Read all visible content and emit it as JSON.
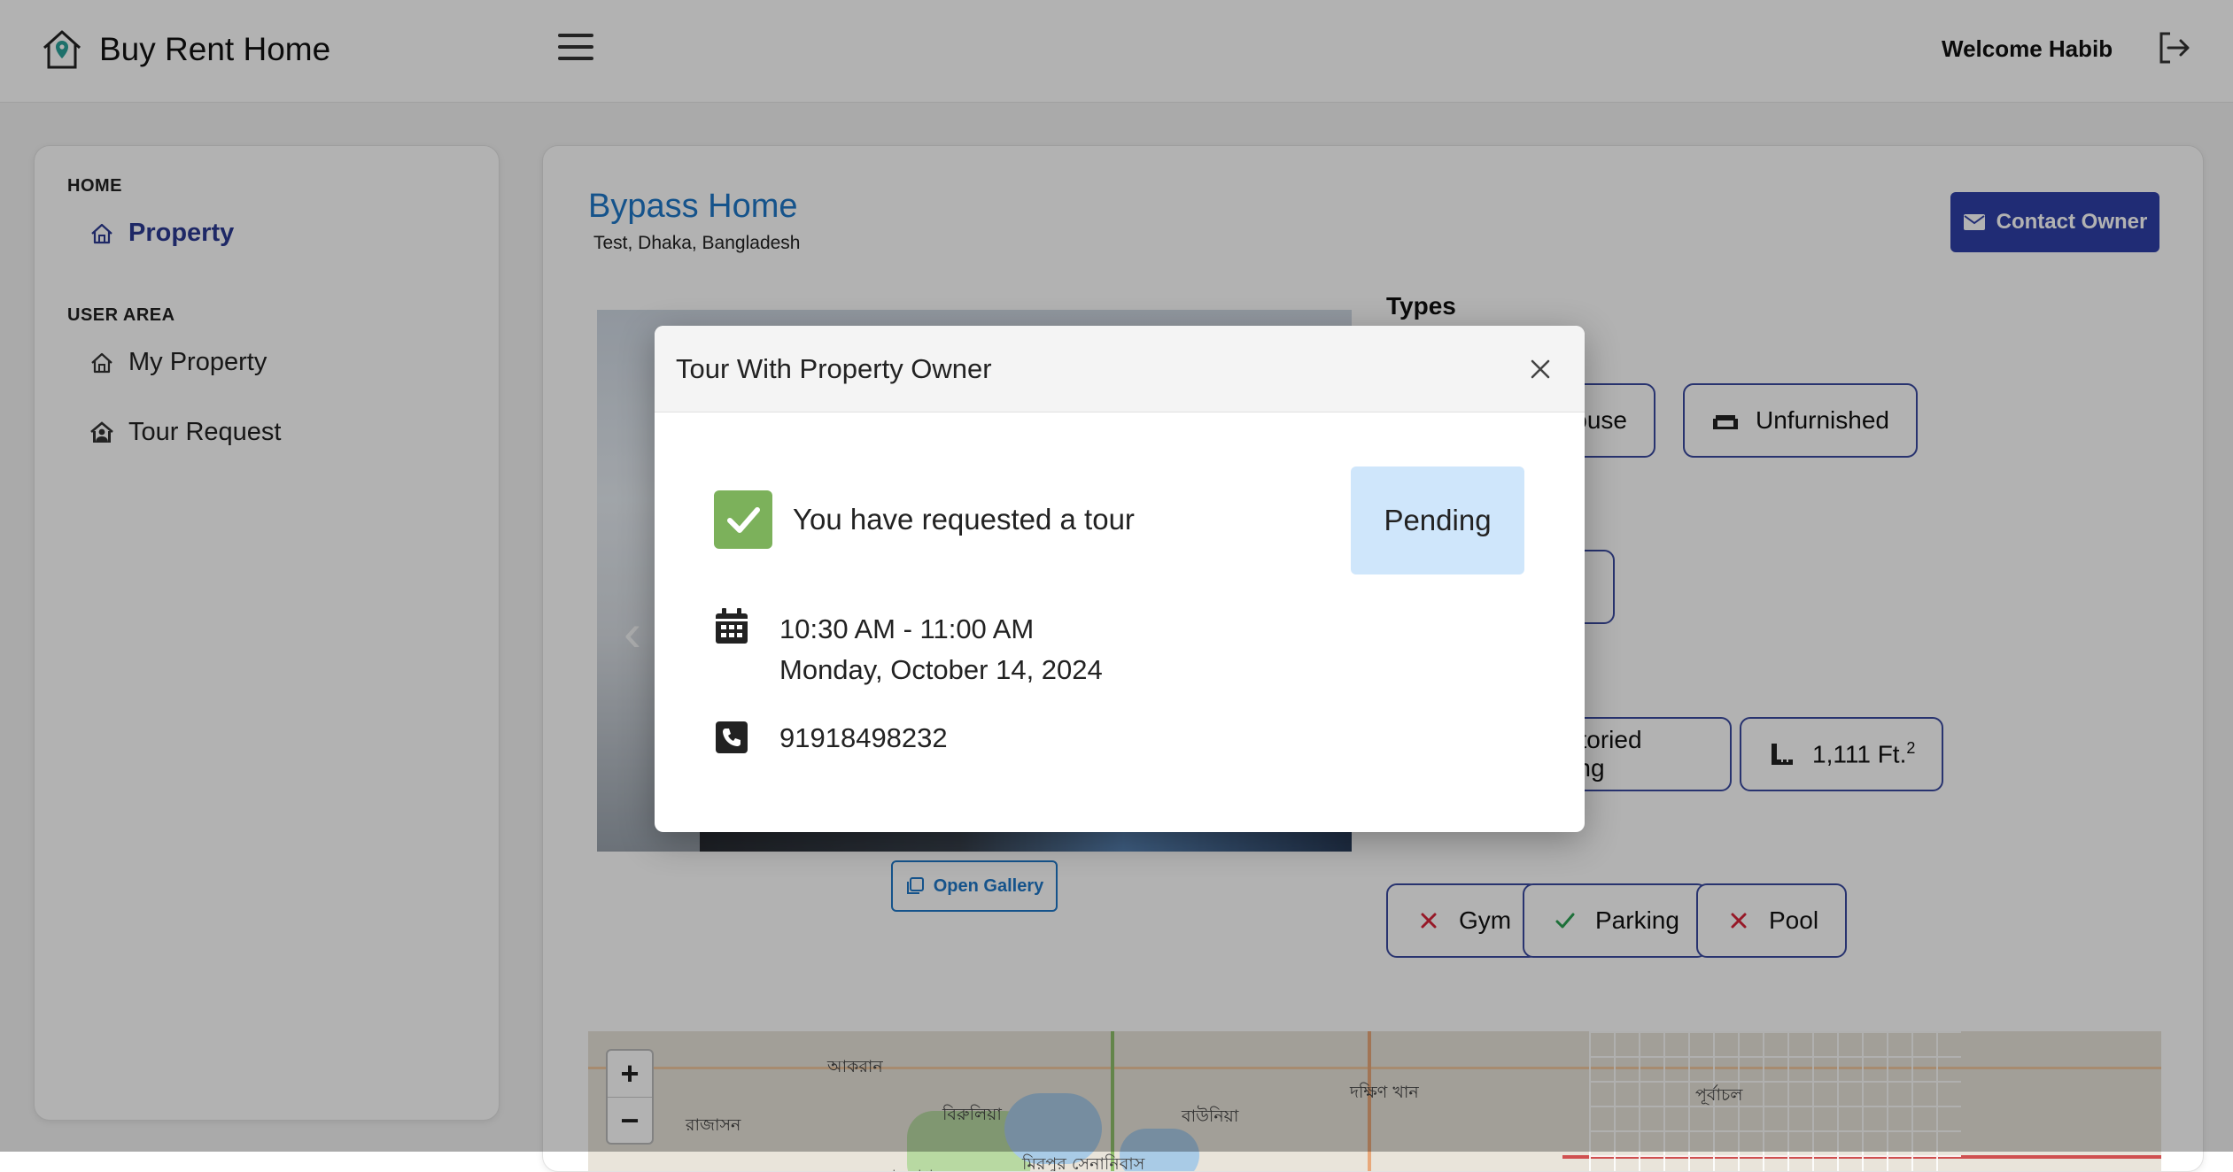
{
  "header": {
    "brand_name": "Buy Rent Home",
    "welcome": "Welcome Habib"
  },
  "sidebar": {
    "sections": [
      {
        "title": "HOME",
        "items": [
          {
            "label": "Property",
            "active": true
          }
        ]
      },
      {
        "title": "USER AREA",
        "items": [
          {
            "label": "My Property"
          },
          {
            "label": "Tour Request"
          }
        ]
      }
    ]
  },
  "property": {
    "title": "Bypass Home",
    "address": "Test, Dhaka, Bangladesh",
    "contact_label": "Contact Owner",
    "gallery_label": "Open Gallery",
    "types_label": "Types",
    "type_chips": [
      "House",
      "Unfurnished"
    ],
    "building_chip": "of 2 storied building",
    "area_chip": "1,111 Ft.",
    "area_unit_sup": "2",
    "amenities": [
      {
        "label": "Gym",
        "available": false
      },
      {
        "label": "Parking",
        "available": true
      },
      {
        "label": "Pool",
        "available": false
      }
    ]
  },
  "map": {
    "labels": [
      "আকরান",
      "বিরুলিয়া",
      "রাজাসন",
      "বাউনিয়া",
      "দক্ষিণ খান",
      "পূর্বাচল",
      "মিরপুর সেনানিবাস",
      "সাদুল্লাপুর"
    ],
    "zoom_in": "+",
    "zoom_out": "−"
  },
  "modal": {
    "title": "Tour With Property Owner",
    "status_text": "You have requested a tour",
    "status_badge": "Pending",
    "time": "10:30 AM - 11:00 AM",
    "date": "Monday, October 14, 2024",
    "phone": "91918498232"
  },
  "colors": {
    "accent": "#2f3fa8",
    "title_blue": "#1f78c8",
    "pending_bg": "#cfe6fb",
    "check_green": "#7cb15b",
    "cross_red": "#d9253a"
  }
}
